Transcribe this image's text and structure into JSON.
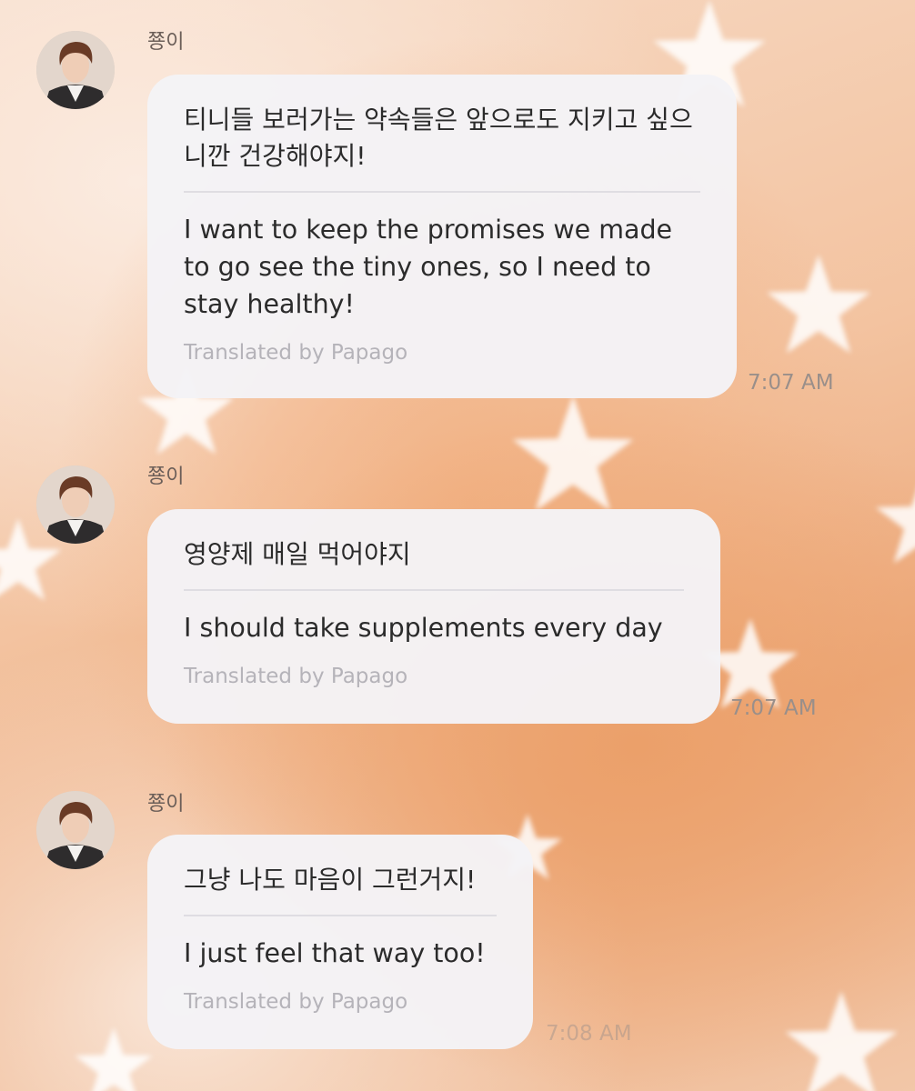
{
  "messages": [
    {
      "sender": "쭁이",
      "original": "티니들 보러가는 약속들은 앞으로도 지키고 싶으니깐 건강해야지!",
      "translation": "I want to keep the promises we made to go see the tiny ones, so I need to stay healthy!",
      "translated_by": "Translated by Papago",
      "time": "7:07 AM"
    },
    {
      "sender": "쭁이",
      "original": "영양제 매일 먹어야지",
      "translation": "I should take supplements every day",
      "translated_by": "Translated by Papago",
      "time": "7:07 AM"
    },
    {
      "sender": "쭁이",
      "original": "그냥 나도 마음이 그런거지!",
      "translation": "I just feel that way too!",
      "translated_by": "Translated by Papago",
      "time": "7:08 AM"
    }
  ],
  "colors": {
    "bubble": "#f4f3f6",
    "text": "#2b2b2b",
    "translated_by": "#b5b3b9",
    "timestamp": "#9a8f8a",
    "background_peach": "#f3c3a0"
  },
  "icons": {
    "avatar": "profile-photo",
    "background_decoration": "star-icon"
  }
}
